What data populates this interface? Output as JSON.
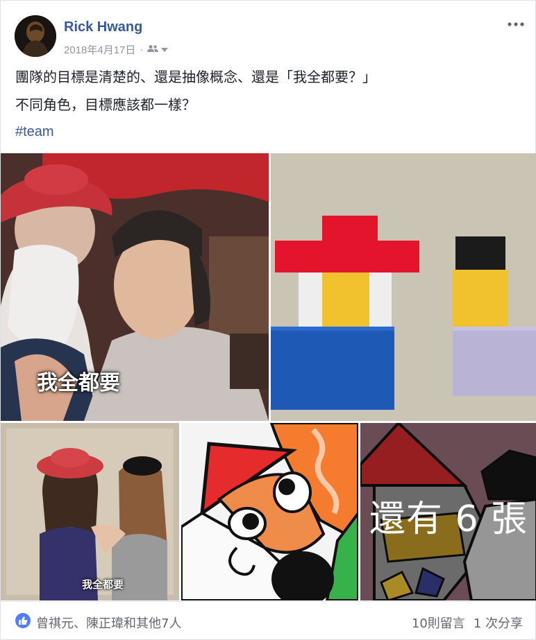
{
  "post": {
    "author": "Rick Hwang",
    "date": "2018年4月17日",
    "separator": "·",
    "audience_icon": "friends-icon",
    "more_icon": "more-options-icon",
    "text_line1": "團隊的目標是清楚的、還是抽像概念、還是「我全都要？」",
    "text_line2": "不同角色，目標應該都一樣？",
    "hashtag": "#team"
  },
  "photos": {
    "photo1_caption": "我全都要",
    "photo3_caption": "我全都要",
    "more_overlay": "還有 6 張"
  },
  "footer": {
    "reaction_icon": "like-icon",
    "reactors": "曾祺元、陳正瑋和其他7人",
    "comments": "10則留言",
    "shares": "1 次分享"
  },
  "colors": {
    "link": "#385898",
    "meta": "#90949c",
    "like_blue": "#4f7dff"
  }
}
